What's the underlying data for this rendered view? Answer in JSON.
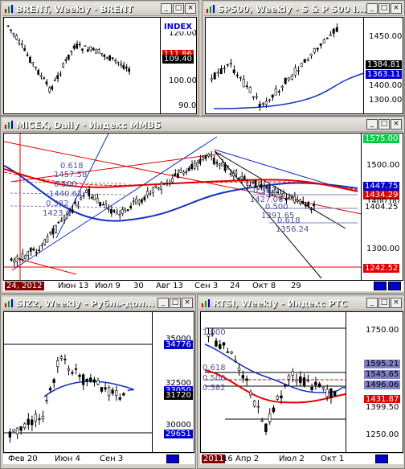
{
  "windows": {
    "brent": {
      "title": "BRENT, Weekly - BRENT",
      "axis_labels": [
        "120.00",
        "100.00",
        "90.00"
      ],
      "index_label": "INDEX",
      "price_tags": [
        "111.86",
        "109.40"
      ],
      "date_labels": []
    },
    "sp500": {
      "title": "SP500, Weekly - S & P 500 I...",
      "axis_labels": [
        "1450.00",
        "1400.00",
        "1300.00"
      ],
      "price_tags": [
        "1384.81",
        "1363.11"
      ],
      "date_labels": []
    },
    "micex": {
      "title": "MICEX, Daily - Индекс ММВБ",
      "axis_labels": [
        "1575.00",
        "1500.00",
        "1400.00",
        "1300.00"
      ],
      "price_tags": [
        "1447.75",
        "1434.29",
        "1404.25",
        "1242.52"
      ],
      "date_labels": [
        "24, 2012",
        "Июн 13",
        "Июл 9",
        "30",
        "Авг 13",
        "Сен 3",
        "24",
        "Окт 8",
        "29"
      ],
      "fib_left": [
        "0.618",
        "1457.58",
        "0.500",
        "1440.62",
        "0.382",
        "1423.6"
      ],
      "fib_right": [
        "0.382",
        "1427.06",
        "0.500",
        "1391.65",
        "0.618",
        "1356.24"
      ]
    },
    "si": {
      "title": "SIZ2, Weekly - Рубль-дол...",
      "axis_labels": [
        "35000",
        "32500",
        "30000"
      ],
      "price_tags": [
        "34776",
        "33050",
        "31720",
        "29651"
      ],
      "date_labels": [
        "Фев 20",
        "Июн 4",
        "Сен 3"
      ]
    },
    "rtsi": {
      "title": "RTSI, Weekly - Индекс РТС",
      "axis_labels": [
        "1750.00",
        "1250.00"
      ],
      "price_tags": [
        "1595.21",
        "1545.65",
        "1496.06",
        "1431.87",
        "1399.50"
      ],
      "date_labels": [
        "2011",
        "16",
        "Апр 2",
        "Июл 2",
        "Окт 1"
      ],
      "fib_labels": [
        "1.000",
        "0.618",
        "0.500",
        "0.382"
      ]
    }
  },
  "colors": {
    "up_candle": "#ffffff",
    "down_candle": "#000000",
    "ma_red": "#e00000",
    "ma_blue": "#1030c0",
    "tag_red": "#e00000",
    "tag_blue": "#0000cc",
    "tag_green": "#00cc44",
    "tag_black": "#000000",
    "tag_lav": "#8080c0"
  }
}
